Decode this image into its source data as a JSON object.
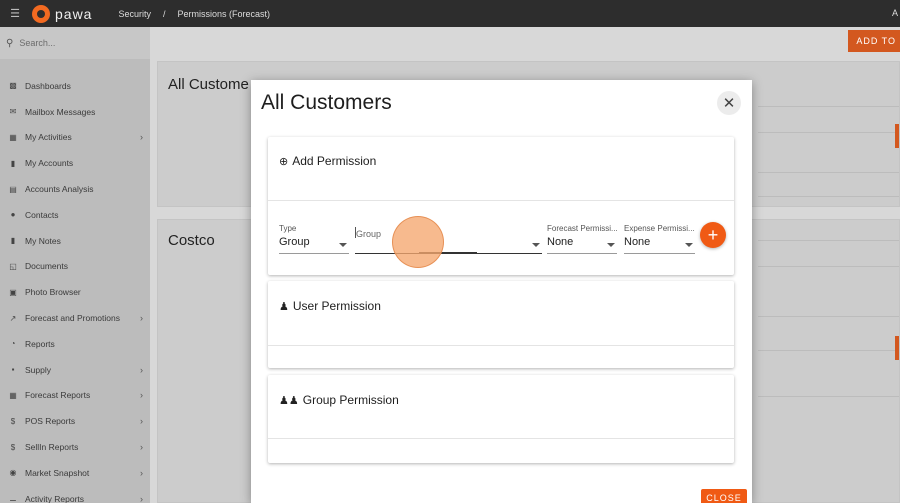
{
  "topbar": {
    "logo_text": "pawa",
    "breadcrumb": [
      "Security",
      "/",
      "Permissions (Forecast)"
    ],
    "right_letter": "A"
  },
  "sidebar": {
    "search_placeholder": "Search...",
    "items": [
      {
        "label": "Dashboards",
        "icon": "chart-icon",
        "chevron": false
      },
      {
        "label": "Mailbox Messages",
        "icon": "envelope-icon",
        "chevron": false
      },
      {
        "label": "My Activities",
        "icon": "calendar-icon",
        "chevron": true
      },
      {
        "label": "My Accounts",
        "icon": "book-icon",
        "chevron": false
      },
      {
        "label": "Accounts Analysis",
        "icon": "bar-chart-icon",
        "chevron": false
      },
      {
        "label": "Contacts",
        "icon": "user-icon",
        "chevron": false
      },
      {
        "label": "My Notes",
        "icon": "note-icon",
        "chevron": false
      },
      {
        "label": "Documents",
        "icon": "document-icon",
        "chevron": false
      },
      {
        "label": "Photo Browser",
        "icon": "photo-icon",
        "chevron": false
      },
      {
        "label": "Forecast and Promotions",
        "icon": "trend-icon",
        "chevron": true
      },
      {
        "label": "Reports",
        "icon": "pie-icon",
        "chevron": false
      },
      {
        "label": "Supply",
        "icon": "truck-icon",
        "chevron": true
      },
      {
        "label": "Forecast Reports",
        "icon": "table-icon",
        "chevron": true
      },
      {
        "label": "POS Reports",
        "icon": "dollar-icon",
        "chevron": true
      },
      {
        "label": "SellIn Reports",
        "icon": "dollar-icon",
        "chevron": true
      },
      {
        "label": "Market Snapshot",
        "icon": "camera-icon",
        "chevron": true
      },
      {
        "label": "Activity Reports",
        "icon": "activity-icon",
        "chevron": true
      }
    ]
  },
  "content": {
    "add_button": "ADD TO",
    "cards": [
      "All Custome",
      "Costco"
    ]
  },
  "modal": {
    "title": "All Customers",
    "add_permission": {
      "heading": "Add Permission",
      "type": {
        "label": "Type",
        "value": "Group"
      },
      "group": {
        "label": "Group",
        "value": ""
      },
      "forecast": {
        "label": "Forecast Permissi...",
        "value": "None"
      },
      "expense": {
        "label": "Expense Permissi...",
        "value": "None"
      },
      "add_symbol": "+"
    },
    "user_permission": {
      "heading": "User Permission"
    },
    "group_permission": {
      "heading": "Group Permission"
    },
    "close_label": "CLOSE"
  },
  "colors": {
    "accent": "#f05a14",
    "topbar": "#2d2d2d"
  }
}
